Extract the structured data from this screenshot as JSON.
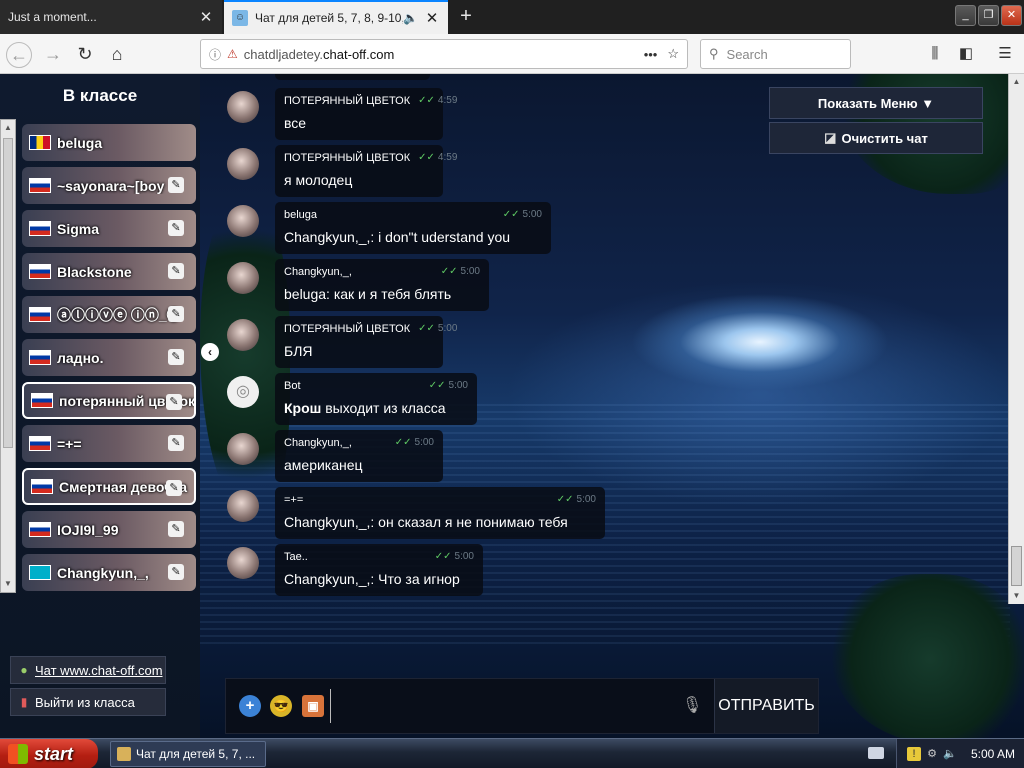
{
  "browser": {
    "tabs": [
      {
        "title": "Just a moment...",
        "active": false
      },
      {
        "title": "Чат для детей 5, 7, 8, 9-10,",
        "active": true
      }
    ],
    "url_prefix": "chatdljadetey.",
    "url_domain": "chat-off.com",
    "search_placeholder": "Search",
    "window_buttons": {
      "minimize": "_",
      "restore": "❐",
      "close": "✕"
    }
  },
  "sidebar": {
    "title": "В классе",
    "users": [
      {
        "name": "beluga",
        "flag": "ro",
        "pm": false,
        "highlight": false
      },
      {
        "name": "~sayonara~[boy",
        "flag": "ru",
        "pm": true,
        "highlight": false
      },
      {
        "name": "Sigma",
        "flag": "ru",
        "pm": true,
        "highlight": false
      },
      {
        "name": "Blackstone",
        "flag": "ru",
        "pm": true,
        "highlight": false
      },
      {
        "name": "ⓐⓛⓘⓥⓔ ⓘⓝ_ⓘ",
        "flag": "ru",
        "pm": true,
        "highlight": false
      },
      {
        "name": "ладно.",
        "flag": "ru",
        "pm": true,
        "highlight": false
      },
      {
        "name": "потерянный цветок",
        "flag": "ru",
        "pm": true,
        "highlight": true
      },
      {
        "name": "=+=",
        "flag": "ru",
        "pm": true,
        "highlight": false
      },
      {
        "name": "Смертная девочка",
        "flag": "ru",
        "pm": true,
        "highlight": true
      },
      {
        "name": "IOJI9I_99",
        "flag": "ru",
        "pm": true,
        "highlight": false
      },
      {
        "name": "Changkyun,_,",
        "flag": "kz",
        "pm": true,
        "highlight": false
      }
    ],
    "links": {
      "site": "Чат www.chat-off.com",
      "exit": "Выйти из класса"
    }
  },
  "messages": [
    {
      "name": "ПОТЕРЯННЫЙ ЦВЕТОК",
      "time": "4:59",
      "text": "все",
      "bot": false
    },
    {
      "name": "ПОТЕРЯННЫЙ ЦВЕТОК",
      "time": "4:59",
      "text": "я молодец",
      "bot": false
    },
    {
      "name": "beluga",
      "time": "5:00",
      "text": "Changkyun,_,: i don\"t uderstand  you",
      "bot": false
    },
    {
      "name": "Changkyun,_,",
      "time": "5:00",
      "text": "beluga: как и я тебя блять",
      "bot": false
    },
    {
      "name": "ПОТЕРЯННЫЙ ЦВЕТОК",
      "time": "5:00",
      "text": "БЛЯ",
      "bot": false
    },
    {
      "name": "Bot",
      "time": "5:00",
      "text_bold": "Крош",
      "text": " выходит из класса",
      "bot": true
    },
    {
      "name": "Changkyun,_,",
      "time": "5:00",
      "text": "американец",
      "bot": false
    },
    {
      "name": "=+=",
      "time": "5:00",
      "text": "Changkyun,_,: он сказал я не понимаю тебя",
      "bot": false
    },
    {
      "name": "Tae..",
      "time": "5:00",
      "text": "Changkyun,_,: Что за игнор",
      "bot": false
    }
  ],
  "menu": {
    "show_menu": "Показать Меню ▼",
    "clear_chat": "Очистить чат"
  },
  "composer": {
    "input_value": "",
    "send_label": "ОТПРАВИТЬ"
  },
  "taskbar": {
    "start_label": "start",
    "task_item": "Чат для детей 5, 7, ...",
    "clock": "5:00 AM"
  },
  "colors": {
    "tab_accent": "#0a84ff",
    "read_ticks": "#5fc964",
    "start_red": "#c1261a"
  },
  "icons": {
    "tab_close": "close-icon",
    "new_tab": "plus-icon",
    "back": "arrow-left-icon",
    "forward": "arrow-right-icon",
    "reload": "reload-icon",
    "home": "home-icon",
    "search": "search-icon",
    "library": "library-icon",
    "sidebar_toggle": "sidebar-icon",
    "menu": "hamburger-icon",
    "pm": "private-message-icon",
    "add": "plus-circle-icon",
    "emoji": "emoji-icon",
    "sticker": "sticker-icon",
    "mic": "microphone-icon"
  }
}
